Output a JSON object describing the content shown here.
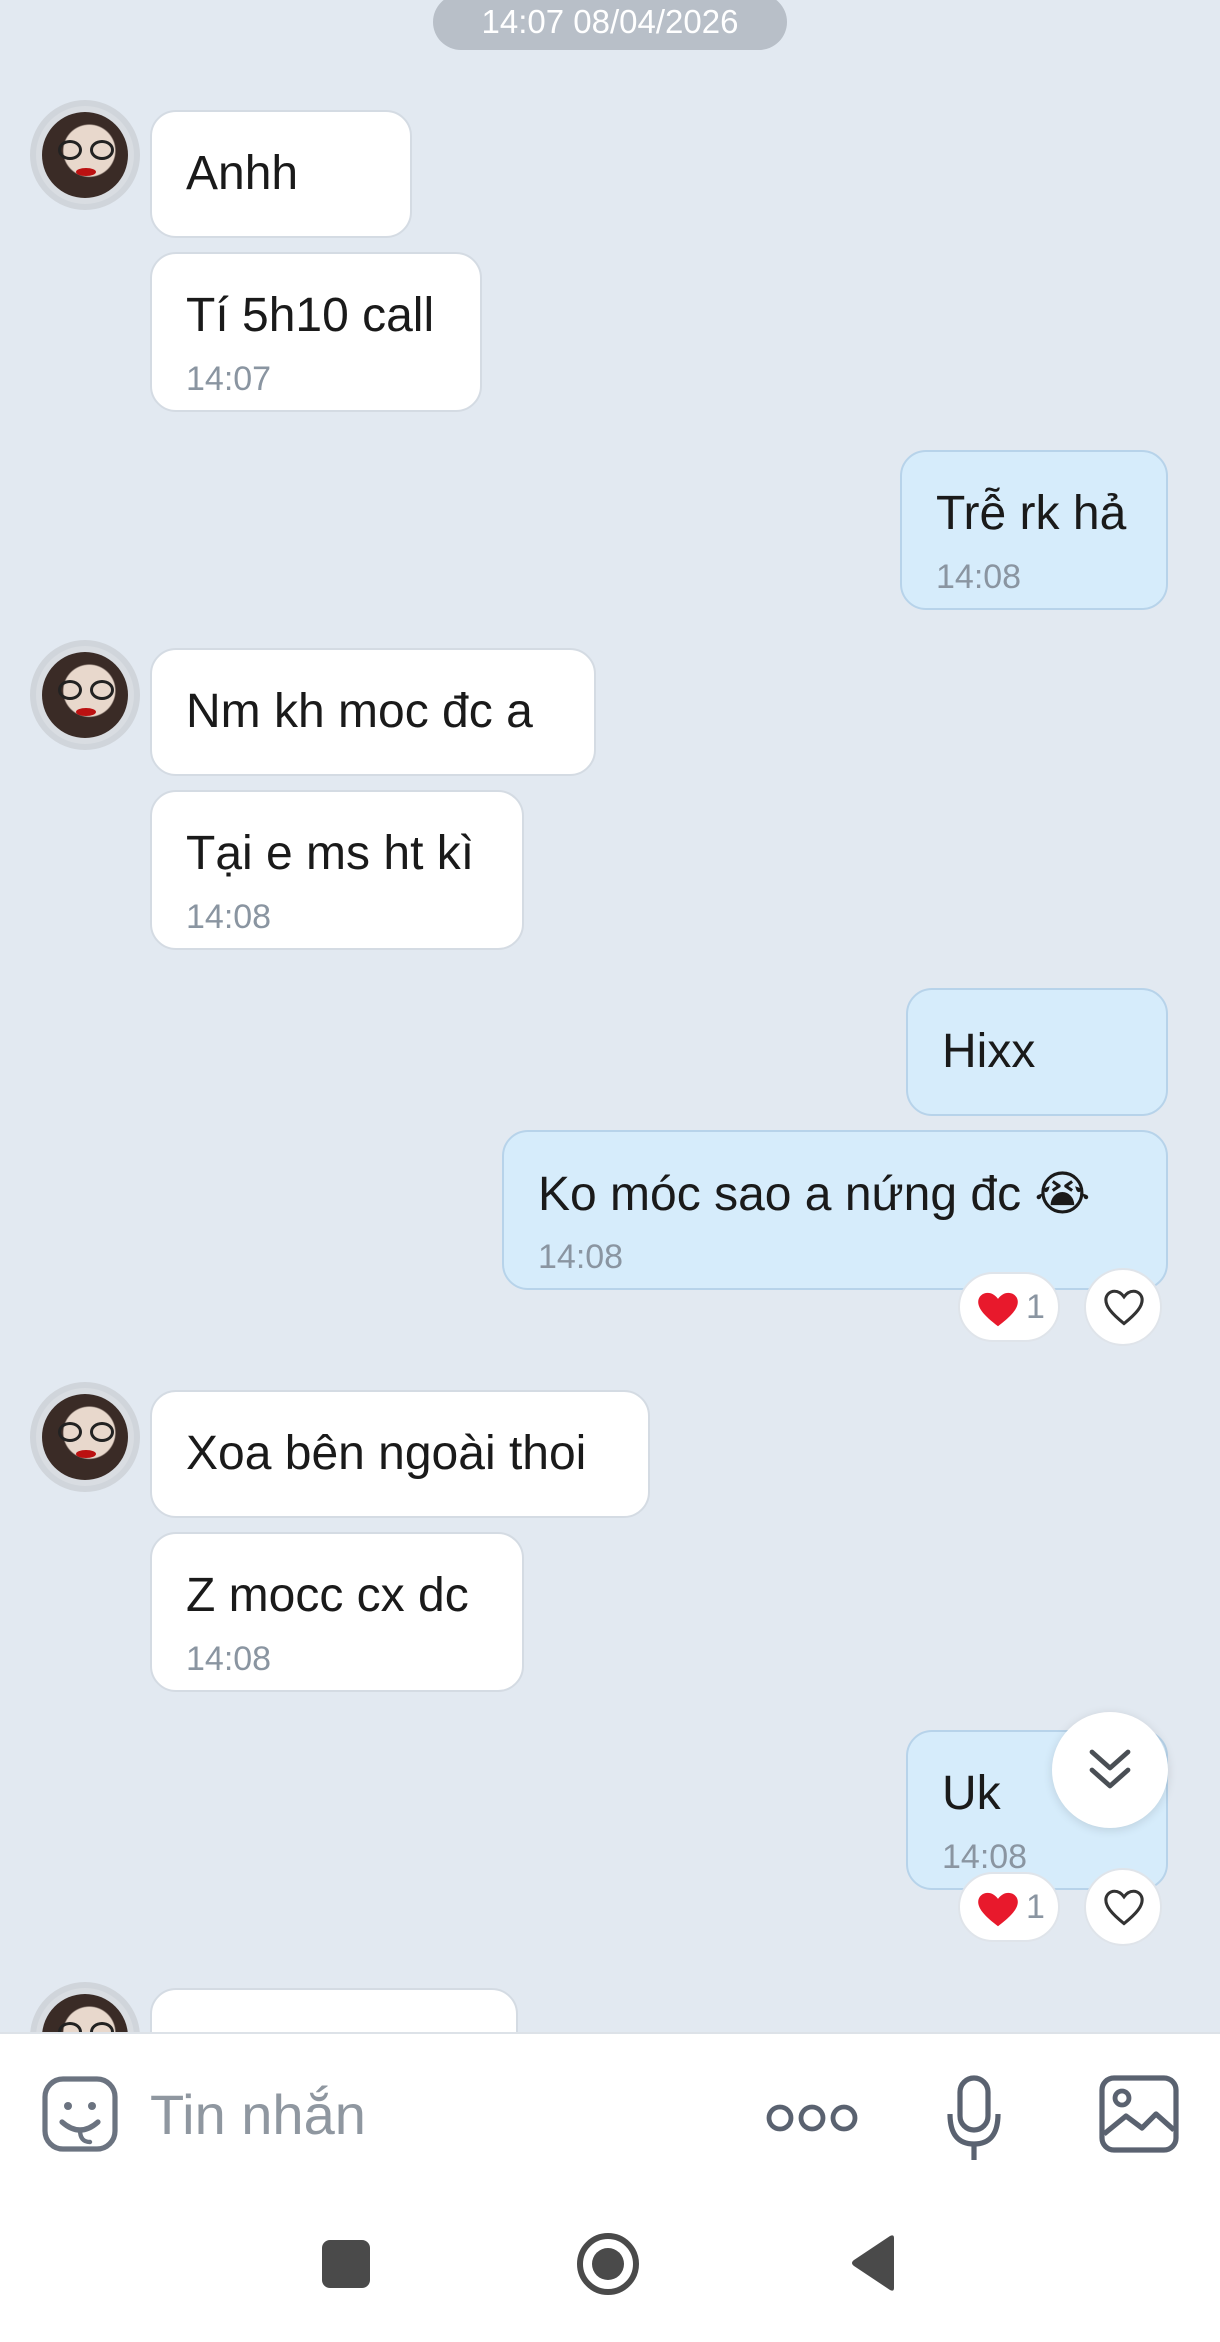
{
  "date_separator": "14:07 08/04/2026",
  "messages": [
    {
      "text": "Anhh"
    },
    {
      "text": "Tí 5h10 call",
      "time": "14:07"
    },
    {
      "text": "Trễ rk hả",
      "time": "14:08"
    },
    {
      "text": "Nm kh moc đc a"
    },
    {
      "text": "Tại e ms ht kì",
      "time": "14:08"
    },
    {
      "text": "Hixx"
    },
    {
      "text": "Ko móc sao a nứng đc 😭",
      "time": "14:08",
      "reaction_count": "1"
    },
    {
      "text": "Xoa bên ngoài thoi"
    },
    {
      "text": "Z mocc cx dc",
      "time": "14:08"
    },
    {
      "text": "Uk",
      "time": "14:08",
      "reaction_count": "1"
    }
  ],
  "input": {
    "placeholder": "Tin nhắn"
  },
  "icons": {
    "sticker": "sticker-icon",
    "more": "more-icon",
    "mic": "microphone-icon",
    "gallery": "image-icon",
    "scroll_down": "double-chevron-down-icon",
    "heart": "heart-icon"
  },
  "colors": {
    "background": "#e2e9f1",
    "incoming_bubble": "#ffffff",
    "outgoing_bubble": "#d6ecfb",
    "reaction_heart": "#e8192c"
  }
}
